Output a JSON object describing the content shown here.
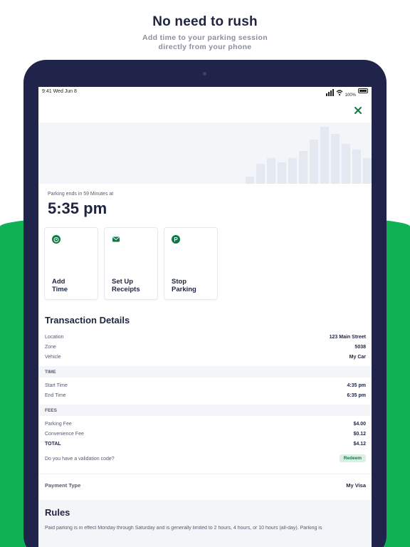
{
  "promo": {
    "headline": "No need to rush",
    "subhead_line1": "Add time to your parking session",
    "subhead_line2": "directly from your phone"
  },
  "status_bar": {
    "time": "9:41  Wed Jun 8",
    "battery": "100%"
  },
  "session": {
    "ends_label": "Parking ends in 59 Minutes at",
    "ends_time": "5:35 pm"
  },
  "actions": [
    {
      "label_line1": "Add",
      "label_line2": "Time",
      "icon": "alarm-clock-icon"
    },
    {
      "label_line1": "Set Up",
      "label_line2": "Receipts",
      "icon": "envelope-icon"
    },
    {
      "label_line1": "Stop",
      "label_line2": "Parking",
      "icon": "parking-icon"
    }
  ],
  "transaction": {
    "title": "Transaction Details",
    "location_label": "Location",
    "location_value": "123 Main Street",
    "zone_label": "Zone",
    "zone_value": "5038",
    "vehicle_label": "Vehicle",
    "vehicle_value": "My Car",
    "time_header": "TIME",
    "start_label": "Start Time",
    "start_value": "4:35 pm",
    "end_label": "End Time",
    "end_value": "6:35 pm",
    "fees_header": "FEES",
    "parking_fee_label": "Parking Fee",
    "parking_fee_value": "$4.00",
    "convenience_fee_label": "Convenience Fee",
    "convenience_fee_value": "$0.12",
    "total_label": "TOTAL",
    "total_value": "$4.12",
    "validation_question": "Do you have a validation code?",
    "redeem_label": "Redeem",
    "payment_label": "Payment Type",
    "payment_value": "My Visa"
  },
  "rules": {
    "title": "Rules",
    "text": "Paid parking is in effect Monday through Saturday and is generally limited to 2 hours, 4 hours, or 10 hours (all-day). Parking is"
  },
  "colors": {
    "brand_green": "#0fb155",
    "accent_green": "#0d7a45",
    "navy": "#20244a"
  }
}
